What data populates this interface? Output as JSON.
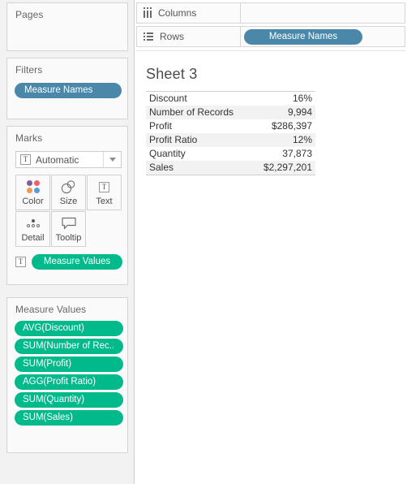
{
  "app": {
    "product": "Tableau"
  },
  "pages_card": {
    "title": "Pages"
  },
  "filters_card": {
    "title": "Filters",
    "pills": [
      {
        "label": "Measure Names",
        "color": "#4a87a8"
      }
    ]
  },
  "marks_card": {
    "title": "Marks",
    "mark_type": {
      "label": "Automatic",
      "icon": "text-box-icon",
      "caret": "chevron-down-icon"
    },
    "buttons": [
      {
        "id": "color",
        "label": "Color",
        "icon": "color-dots-icon"
      },
      {
        "id": "size",
        "label": "Size",
        "icon": "size-circles-icon"
      },
      {
        "id": "text",
        "label": "Text",
        "icon": "text-box-icon"
      },
      {
        "id": "detail",
        "label": "Detail",
        "icon": "detail-dots-icon"
      },
      {
        "id": "tooltip",
        "label": "Tooltip",
        "icon": "tooltip-bubble-icon"
      }
    ],
    "color_dots": [
      "#7c5fa0",
      "#f25f6e",
      "#f2994a",
      "#5b9bd5"
    ],
    "pill": {
      "label": "Measure Values",
      "color": "#00ba8c",
      "prefix_icon": "text-box-icon"
    }
  },
  "measure_values_card": {
    "title": "Measure Values",
    "pills": [
      {
        "label": "AVG(Discount)",
        "color": "#00ba8c"
      },
      {
        "label": "SUM(Number of Rec..",
        "color": "#00ba8c"
      },
      {
        "label": "SUM(Profit)",
        "color": "#00ba8c"
      },
      {
        "label": "AGG(Profit Ratio)",
        "color": "#00ba8c"
      },
      {
        "label": "SUM(Quantity)",
        "color": "#00ba8c"
      },
      {
        "label": "SUM(Sales)",
        "color": "#00ba8c"
      }
    ]
  },
  "shelves": {
    "columns": {
      "label": "Columns",
      "icon": "columns-icon",
      "pills": []
    },
    "rows": {
      "label": "Rows",
      "icon": "rows-icon",
      "pills": [
        {
          "label": "Measure Names",
          "color": "#4a87a8"
        }
      ]
    }
  },
  "worksheet": {
    "title": "Sheet 3",
    "table": {
      "rows": [
        {
          "measure": "Discount",
          "value": "16%"
        },
        {
          "measure": "Number of Records",
          "value": "9,994"
        },
        {
          "measure": "Profit",
          "value": "$286,397"
        },
        {
          "measure": "Profit Ratio",
          "value": "12%"
        },
        {
          "measure": "Quantity",
          "value": "37,873"
        },
        {
          "measure": "Sales",
          "value": "$2,297,201"
        }
      ]
    }
  },
  "colors": {
    "pill_blue": "#4a87a8",
    "pill_green": "#00ba8c",
    "panel_bg": "#f2f2f2",
    "card_bg": "#fafafa",
    "row_alt_bg": "#f2f2f2"
  }
}
